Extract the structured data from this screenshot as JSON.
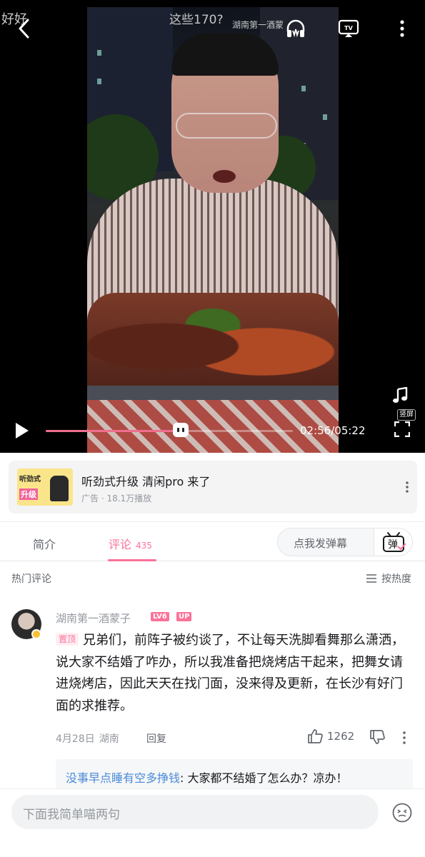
{
  "video": {
    "top_title": "这些170?",
    "corner_text": "好好",
    "watermark": "湖南第一酒蒙",
    "current_time": "02:56",
    "duration": "05:22",
    "time_display": "02:56/05:22",
    "progress": 0.547,
    "vertical_label": "竖屏",
    "tv_label": "TV",
    "icons": {
      "back": "back-arrow-icon",
      "listen": "headphones-icon",
      "tv": "tv-cast-icon",
      "more": "more-vertical-icon",
      "play": "play-icon",
      "music": "music-note-icon",
      "fullscreen": "fullscreen-icon"
    }
  },
  "ad": {
    "thumb_line1": "听劲式",
    "thumb_line2": "升级",
    "title": "听劲式升级  清闲pro 来了",
    "meta": "广告 · 18.1万播放"
  },
  "tabs": {
    "intro": "简介",
    "comments": "评论",
    "comment_count": "435",
    "danmaku_placeholder": "点我发弹幕",
    "danmaku_button": "弹"
  },
  "comments_section": {
    "hot_label": "热门评论",
    "sort_label": "按热度",
    "top_comment": {
      "username": "湖南第一酒蒙子",
      "level_badge": "LV6",
      "up_badge": "UP",
      "pinned_tag": "置顶",
      "text": "兄弟们，前阵子被约谈了，不让每天洗脚看舞那么潇洒，说大家不结婚了咋办，所以我准备把烧烤店干起来，把舞女请进烧烤店，因此天天在找门面，没来得及更新，在长沙有好门面的求推荐。",
      "date": "4月28日",
      "location": "湖南",
      "reply_label": "回复",
      "likes": "1262",
      "sub_reply": {
        "author": "没事早点睡有空多挣钱",
        "text": ": 大家都不结婚了怎么办？凉办！"
      }
    }
  },
  "bottom": {
    "input_placeholder": "下面我简单喵两句"
  },
  "colors": {
    "accent": "#fb7299",
    "link": "#4b8bd6",
    "muted": "#9499a0"
  }
}
